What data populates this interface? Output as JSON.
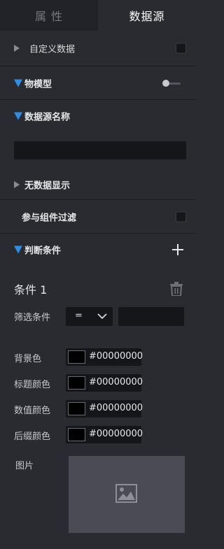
{
  "tabs": [
    {
      "label": "属 性",
      "active": false
    },
    {
      "label": "数据源",
      "active": true
    }
  ],
  "sections": {
    "custom_data": {
      "label": "自定义数据",
      "expanded": false,
      "checked": false
    },
    "thing_model": {
      "label": "物模型",
      "expanded": true,
      "toggle_on": false
    },
    "datasource_name": {
      "label": "数据源名称",
      "expanded": true,
      "value": ""
    },
    "no_data_display": {
      "label": "无数据显示",
      "expanded": false
    },
    "join_filter": {
      "label": "参与组件过滤",
      "checked": false
    },
    "judge_conditions": {
      "label": "判断条件",
      "expanded": true
    }
  },
  "condition": {
    "title": "条件 1",
    "filter_label": "筛选条件",
    "operator": "=",
    "filter_value": "",
    "colors": [
      {
        "label": "背景色",
        "value": "#00000000"
      },
      {
        "label": "标题颜色",
        "value": "#00000000"
      },
      {
        "label": "数值颜色",
        "value": "#00000000"
      },
      {
        "label": "后缀颜色",
        "value": "#00000000"
      }
    ],
    "image_label": "图片"
  },
  "icons": {
    "collapsed": "caret-right-icon",
    "expanded": "caret-down-icon",
    "add": "plus-icon",
    "delete": "trash-icon",
    "image_placeholder": "image-icon",
    "dropdown": "chevron-down-icon"
  },
  "colors": {
    "accent": "#2f8ce8",
    "panel_bg": "#2a2b31",
    "input_bg": "#15161a"
  }
}
